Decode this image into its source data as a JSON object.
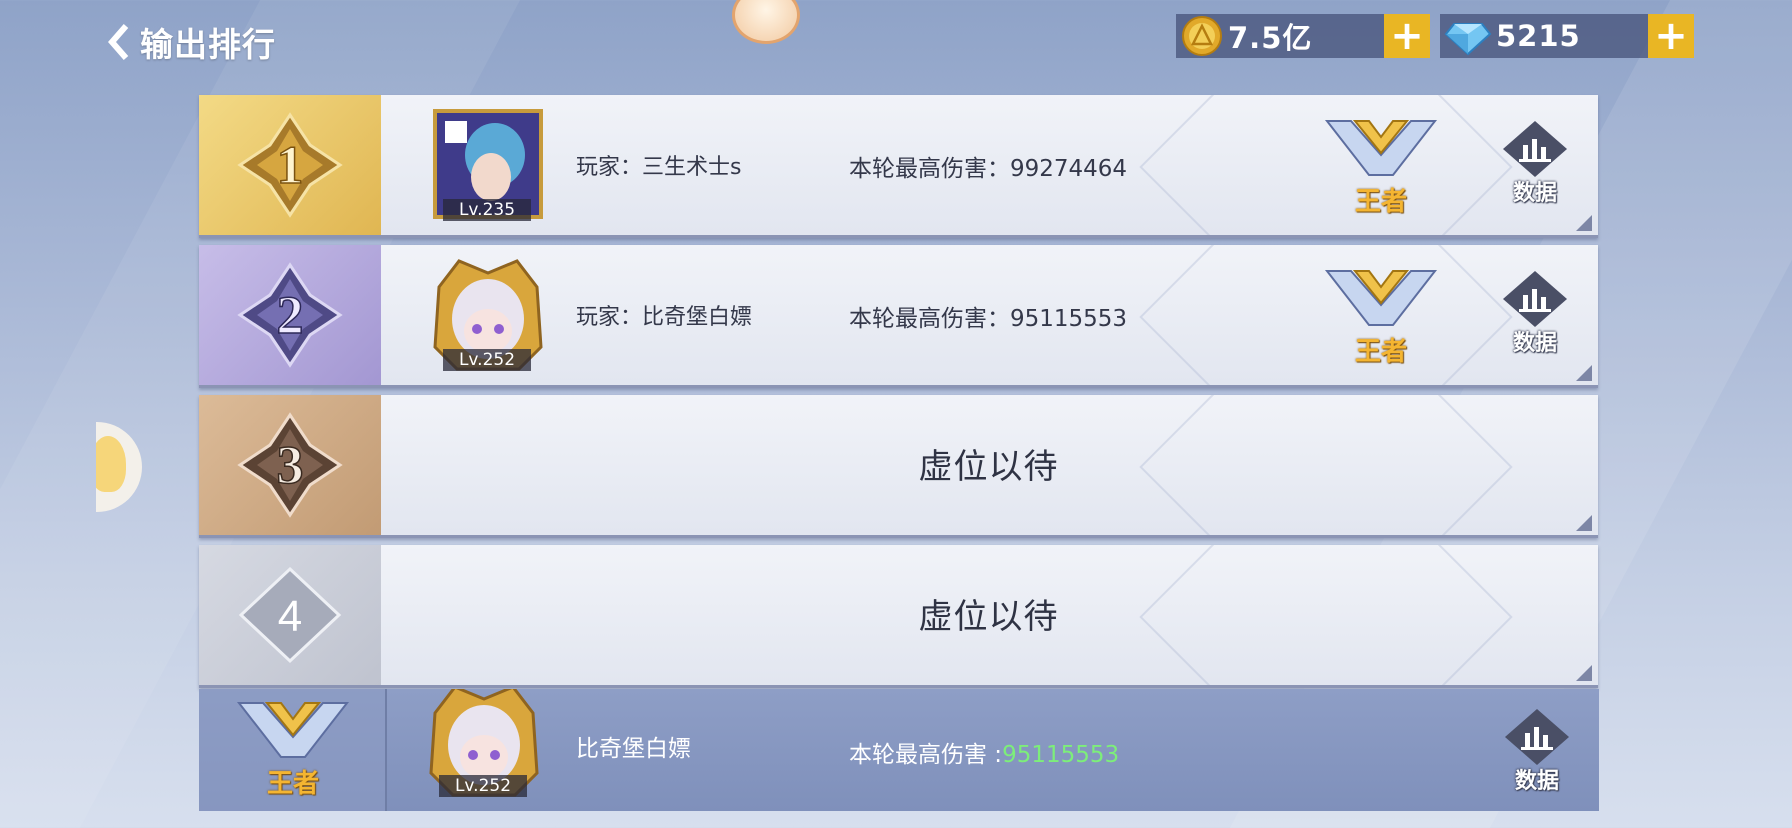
{
  "header": {
    "title": "输出排行"
  },
  "currencies": [
    {
      "icon": "gold-coin-icon",
      "amount": "7.5亿"
    },
    {
      "icon": "diamond-icon",
      "amount": "5215"
    }
  ],
  "plus_symbol": "+",
  "rankings": [
    {
      "rank": "1",
      "player": "玩家：三生术士s",
      "damage_label": "本轮最高伤害：",
      "damage": "99274464",
      "level": "Lv.235",
      "tier": "王者",
      "data_label": "数据"
    },
    {
      "rank": "2",
      "player": "玩家：比奇堡白嫖",
      "damage_label": "本轮最高伤害：",
      "damage": "95115553",
      "level": "Lv.252",
      "tier": "王者",
      "data_label": "数据"
    },
    {
      "rank": "3",
      "empty_text": "虚位以待"
    },
    {
      "rank": "4",
      "empty_text": "虚位以待"
    }
  ],
  "my_rank": {
    "tier": "王者",
    "name": "比奇堡白嫖",
    "level": "Lv.252",
    "damage_label": "本轮最高伤害 :",
    "damage": "95115553",
    "data_label": "数据"
  },
  "colors": {
    "gold": "#e9b624",
    "rank1": "#e8c25a",
    "rank2": "#9f93cf",
    "rank3": "#c7a07a",
    "rank4": "#c9ccd6",
    "damage_highlight": "#7dee7a"
  }
}
